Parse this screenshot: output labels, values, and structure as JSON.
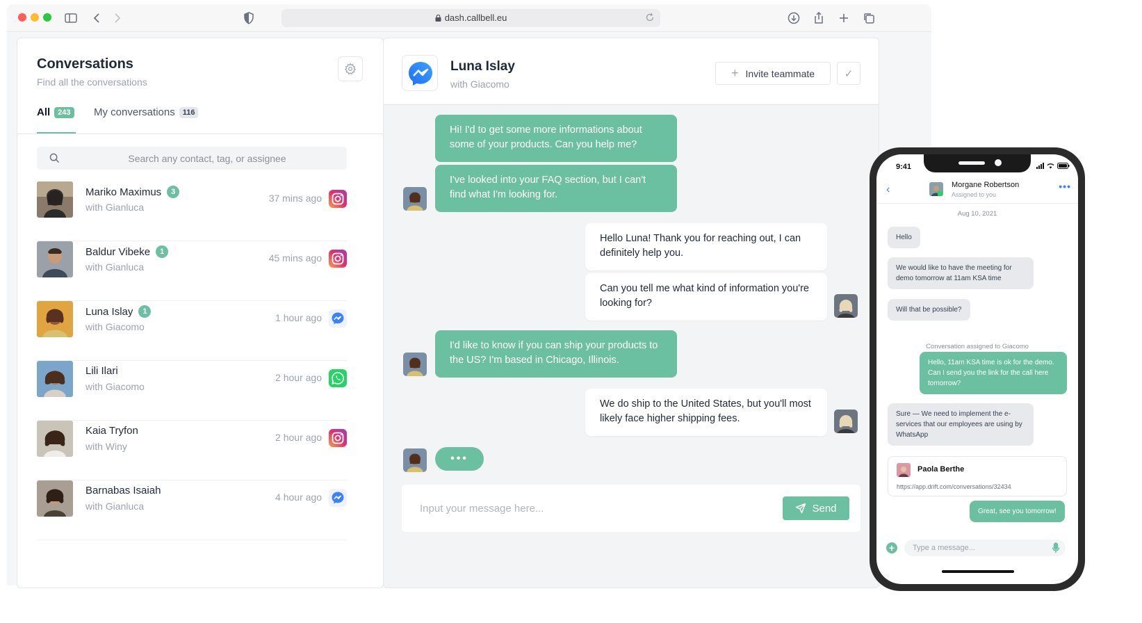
{
  "browser": {
    "url": "dash.callbell.eu"
  },
  "conversations": {
    "title": "Conversations",
    "subtitle": "Find all the conversations",
    "tabs": [
      {
        "label": "All",
        "count": "243"
      },
      {
        "label": "My conversations",
        "count": "116"
      }
    ],
    "search_placeholder": "Search any contact, tag, or assignee",
    "items": [
      {
        "name": "Mariko Maximus",
        "unread": "3",
        "with": "with Gianluca",
        "time": "37 mins ago",
        "channel": "instagram-icon"
      },
      {
        "name": "Baldur Vibeke",
        "unread": "1",
        "with": "with Gianluca",
        "time": "45 mins ago",
        "channel": "instagram-icon"
      },
      {
        "name": "Luna Islay",
        "unread": "1",
        "with": "with Giacomo",
        "time": "1 hour ago",
        "channel": "messenger-icon"
      },
      {
        "name": "Lili Ilari",
        "unread": "",
        "with": "with Giacomo",
        "time": "2 hour ago",
        "channel": "whatsapp-icon"
      },
      {
        "name": "Kaia Tryfon",
        "unread": "",
        "with": "with Winy",
        "time": "2 hour ago",
        "channel": "instagram-icon"
      },
      {
        "name": "Barnabas Isaiah",
        "unread": "",
        "with": "with Gianluca",
        "time": "4 hour ago",
        "channel": "messenger-icon"
      }
    ]
  },
  "chat": {
    "contact_name": "Luna Islay",
    "contact_with": "with Giacomo",
    "invite_label": "Invite teammate",
    "messages": [
      {
        "from": "contact",
        "text": "Hi! I'd to get some more informations about some of your products. Can you help me?"
      },
      {
        "from": "contact",
        "text": "I've looked into your FAQ section, but I can't find what I'm looking for."
      },
      {
        "from": "agent",
        "text": "Hello Luna! Thank you for reaching out, I can definitely help you."
      },
      {
        "from": "agent",
        "text": "Can you tell me what kind of information you're looking for?"
      },
      {
        "from": "contact",
        "text": "I'd like to know if you can ship your products to the US? I'm based in Chicago, Illinois."
      },
      {
        "from": "agent",
        "text": "We do ship to the United States, but you'll most likely face higher shipping fees."
      }
    ],
    "typing_indicator": "•••",
    "input_placeholder": "Input your message here...",
    "send_label": "Send"
  },
  "phone": {
    "time": "9:41",
    "contact_name": "Morgane Robertson",
    "assigned": "Assigned to you",
    "date": "Aug 10, 2021",
    "messages": [
      {
        "from": "contact",
        "text": "Hello"
      },
      {
        "from": "contact",
        "text": "We would like to have the meeting for demo tomorrow at 11am KSA time"
      },
      {
        "from": "contact",
        "text": "Will that be possible?"
      },
      {
        "from": "agent",
        "text": "Hello, 11am KSA time is ok for the demo. Can I send you the link for the call here tomorrow?"
      },
      {
        "from": "contact",
        "text": "Sure — We need to implement the e-services that our employees are using by WhatsApp"
      },
      {
        "from": "agent",
        "text": "Great, see you tomorrow!"
      }
    ],
    "assignment_note": "Conversation assigned to Giacomo",
    "card": {
      "name": "Paola Berthe",
      "link": "https://app.drift.com/conversations/32434"
    },
    "input_placeholder": "Type a message..."
  },
  "colors": {
    "accent": "#6cc0a2",
    "messenger": "#3b82f6",
    "instagram": "#e1306c",
    "whatsapp": "#25d366"
  }
}
